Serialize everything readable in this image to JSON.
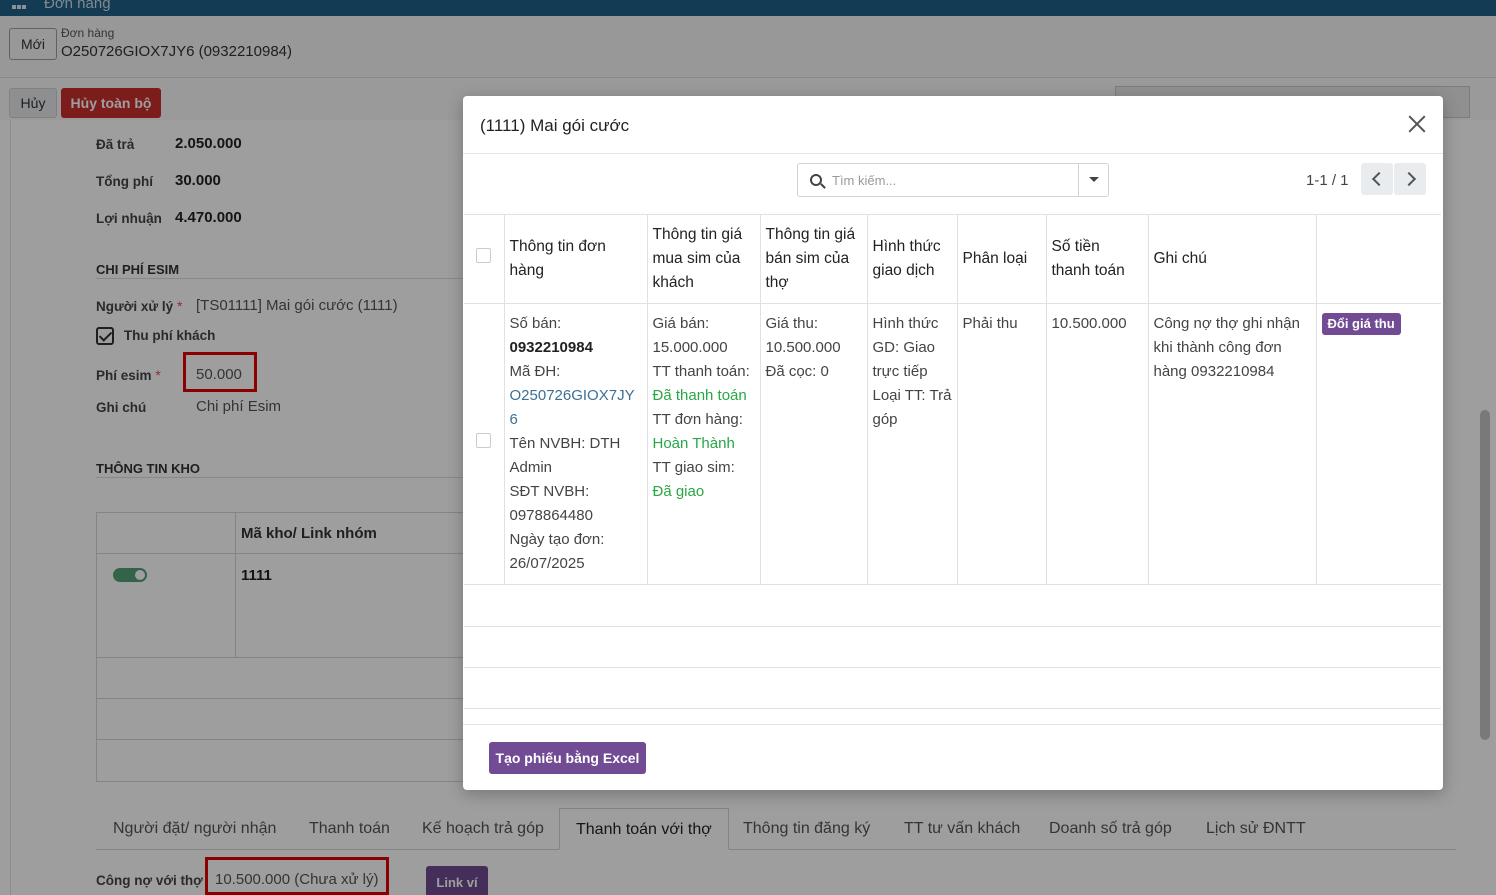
{
  "app": {
    "title": "Đơn hàng"
  },
  "breadcrumb": {
    "new_label": "Mới",
    "parent": "Đơn hàng",
    "record": "O250726GIOX7JY6 (0932210984)"
  },
  "actions": {
    "cancel": "Hủy",
    "cancel_all": "Hủy toàn bộ"
  },
  "summary": {
    "paid_label": "Đã trả",
    "paid_value": "2.050.000",
    "total_fee_label": "Tổng phí",
    "total_fee_value": "30.000",
    "profit_label": "Lợi nhuận",
    "profit_value": "4.470.000"
  },
  "esim": {
    "section": "CHI PHÍ ESIM",
    "handler_label": "Người xử lý",
    "handler_value": "[TS01111] Mai gói cước (1111)",
    "charge_label": "Thu phí khách",
    "fee_label": "Phí esim",
    "fee_value": "50.000",
    "note_label": "Ghi chú",
    "note_value": "Chi phí Esim"
  },
  "warehouse": {
    "section": "THÔNG TIN KHO",
    "col_code": "Mã kho/ Link nhóm",
    "row_code": "1111"
  },
  "tabs": [
    "Người đặt/ người nhận",
    "Thanh toán",
    "Kế hoạch trả góp",
    "Thanh toán với thợ",
    "Thông tin đăng ký",
    "TT tư vấn khách",
    "Doanh số trả góp",
    "Lịch sử ĐNTT"
  ],
  "debt": {
    "label": "Công nợ với thợ",
    "value": "10.500.000 (Chưa xử lý)",
    "link_wallet": "Link ví"
  },
  "modal": {
    "title": "(1111) Mai gói cước",
    "search_placeholder": "Tìm kiếm...",
    "pager": "1-1 / 1",
    "columns": [
      "Thông tin đơn hàng",
      "Thông tin giá mua sim của khách",
      "Thông tin giá bán sim của thợ",
      "Hình thức giao dịch",
      "Phân loại",
      "Số tiền thanh toán",
      "Ghi chú"
    ],
    "row": {
      "order": {
        "sold_label": "Số bán:",
        "sold_value": "0932210984",
        "code_label": "Mã ĐH:",
        "code_value": "O250726GIOX7JY6",
        "staff_label": "Tên NVBH: DTH Admin",
        "phone_label": "SĐT NVBH:",
        "phone_value": "0978864480",
        "date_label": "Ngày tạo đơn:",
        "date_value": "26/07/2025"
      },
      "customer": {
        "price_label": "Giá bán:",
        "price_value": "15.000.000",
        "pay_label": "TT thanh toán:",
        "pay_value": "Đã thanh toán",
        "order_label": "TT đơn hàng:",
        "order_value": "Hoàn Thành",
        "ship_label": "TT giao sim:",
        "ship_value": "Đã giao"
      },
      "worker": {
        "collect": "Giá thu: 10.500.000",
        "deposit": "Đã cọc: 0"
      },
      "mode": {
        "gd": "Hình thức GD: Giao trực tiếp",
        "tt": "Loại TT: Trả góp"
      },
      "category": "Phải thu",
      "amount": "10.500.000",
      "note": "Công nợ thợ ghi nhận khi thành công đơn hàng 0932210984",
      "action": "Đổi giá thu"
    },
    "footer_button": "Tạo phiếu bằng Excel"
  }
}
